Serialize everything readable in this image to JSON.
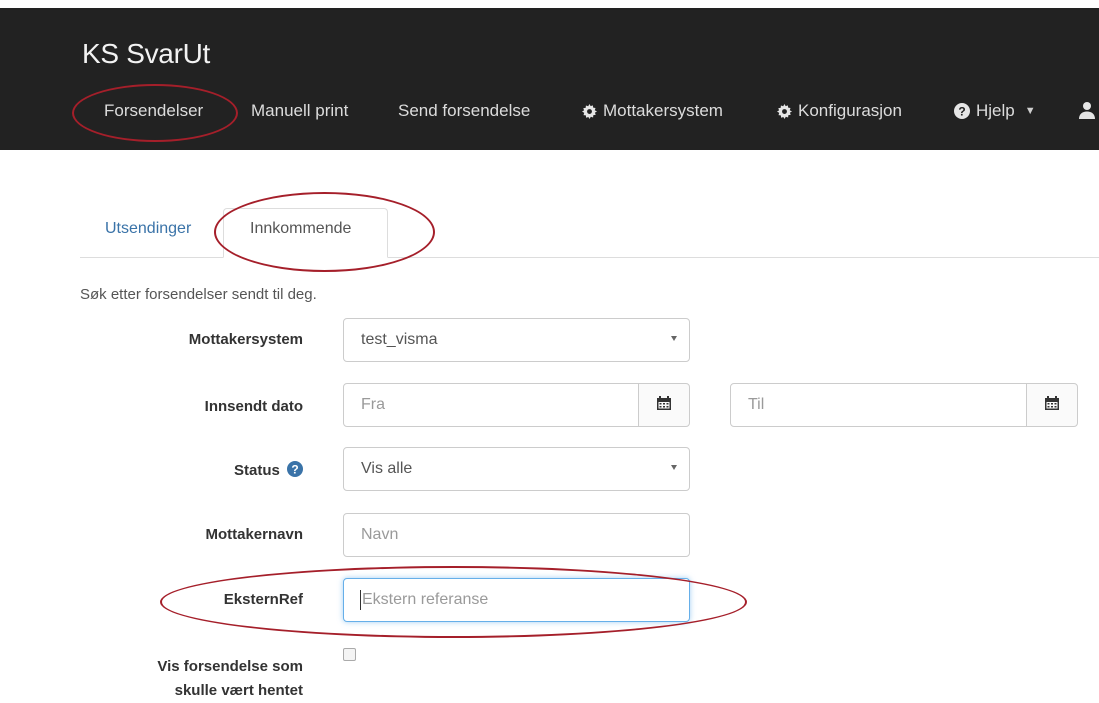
{
  "app": {
    "brand": "KS SvarUt"
  },
  "nav": {
    "items": [
      {
        "label": "Forsendelser",
        "icon": ""
      },
      {
        "label": "Manuell print",
        "icon": ""
      },
      {
        "label": "Send forsendelse",
        "icon": ""
      },
      {
        "label": "Mottakersystem",
        "icon": "gear-icon"
      },
      {
        "label": "Konfigurasjon",
        "icon": "gear-icon"
      },
      {
        "label": "Hjelp",
        "icon": "question-circle-icon"
      }
    ],
    "user_icon": "user-icon"
  },
  "tabs": [
    {
      "label": "Utsendinger",
      "active": false
    },
    {
      "label": "Innkommende",
      "active": true
    }
  ],
  "search": {
    "help": "Søk etter forsendelser sendt til deg.",
    "mottakersystem": {
      "label": "Mottakersystem",
      "value": "test_visma"
    },
    "innsendt_dato": {
      "label": "Innsendt dato",
      "from_placeholder": "Fra",
      "to_placeholder": "Til"
    },
    "status": {
      "label": "Status",
      "value": "Vis alle",
      "info_icon": "question-circle-icon"
    },
    "mottakernavn": {
      "label": "Mottakernavn",
      "placeholder": "Navn"
    },
    "eksternref": {
      "label": "EksternRef",
      "placeholder": "Ekstern referanse"
    },
    "vis_forsendelse": {
      "label_line1": "Vis forsendelse som",
      "label_line2": "skulle vært hentet",
      "checked": false
    }
  },
  "colors": {
    "navbar": "#222222",
    "link": "#3a73a8",
    "highlight": "#a51f2a",
    "focus": "#66afe9"
  }
}
